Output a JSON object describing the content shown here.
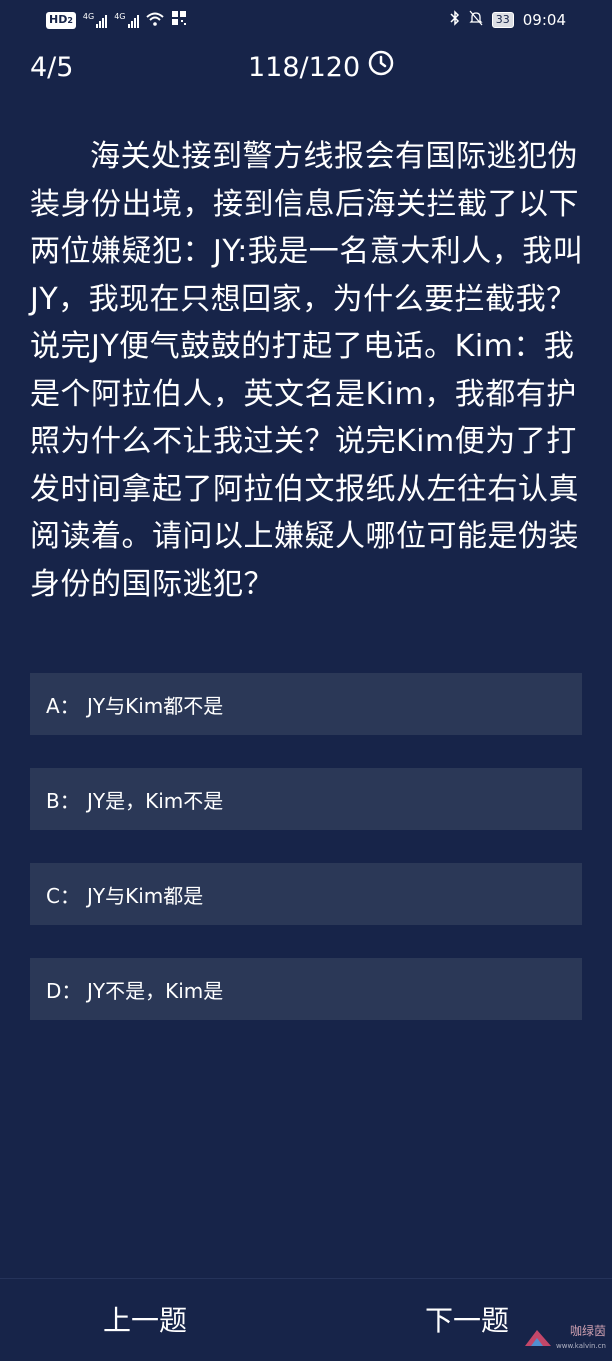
{
  "status_bar": {
    "hd_label": "HD",
    "hd_sub": "2",
    "signal1_tag": "4G",
    "signal2_tag": "4G",
    "battery": "33",
    "time": "09:04"
  },
  "quiz": {
    "progress": "4/5",
    "timer": "118/120",
    "question": "海关处接到警方线报会有国际逃犯伪装身份出境，接到信息后海关拦截了以下两位嫌疑犯：JY:我是一名意大利人，我叫JY，我现在只想回家，为什么要拦截我？ 说完JY便气鼓鼓的打起了电话。Kim：我是个阿拉伯人，英文名是Kim，我都有护照为什么不让我过关？说完Kim便为了打发时间拿起了阿拉伯文报纸从左往右认真阅读着。请问以上嫌疑人哪位可能是伪装身份的国际逃犯？",
    "options": [
      {
        "key": "A：",
        "text": "JY与Kim都不是"
      },
      {
        "key": "B：",
        "text": "JY是，Kim不是"
      },
      {
        "key": "C：",
        "text": "JY与Kim都是"
      },
      {
        "key": "D：",
        "text": "JY不是，Kim是"
      }
    ]
  },
  "nav": {
    "prev": "上一题",
    "next": "下一题"
  },
  "watermark": {
    "text": "咖绿茵",
    "url": "www.kalvin.cn"
  },
  "colors": {
    "background": "#172449",
    "option_bg": "#2b3857",
    "text": "#ffffff"
  }
}
